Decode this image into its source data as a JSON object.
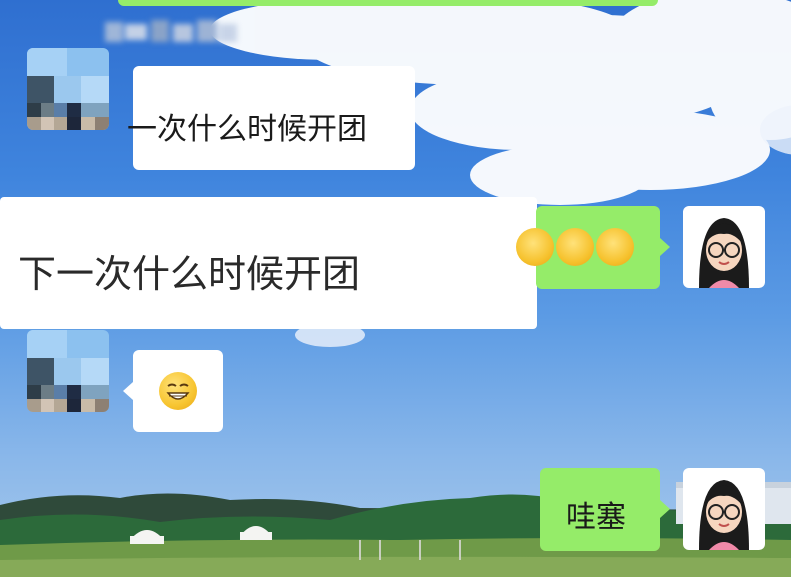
{
  "chat": {
    "messages": [
      {
        "sender": "other",
        "text": "一次什么时候开团"
      },
      {
        "sender": "other",
        "text": "下一次什么时候开团"
      },
      {
        "sender": "self",
        "text": "😂😂😂"
      },
      {
        "sender": "other",
        "text": "😁"
      },
      {
        "sender": "self",
        "text": "哇塞"
      }
    ]
  },
  "colors": {
    "self_bubble": "#95ec69",
    "other_bubble": "#ffffff",
    "sky": "#3f84dd"
  }
}
